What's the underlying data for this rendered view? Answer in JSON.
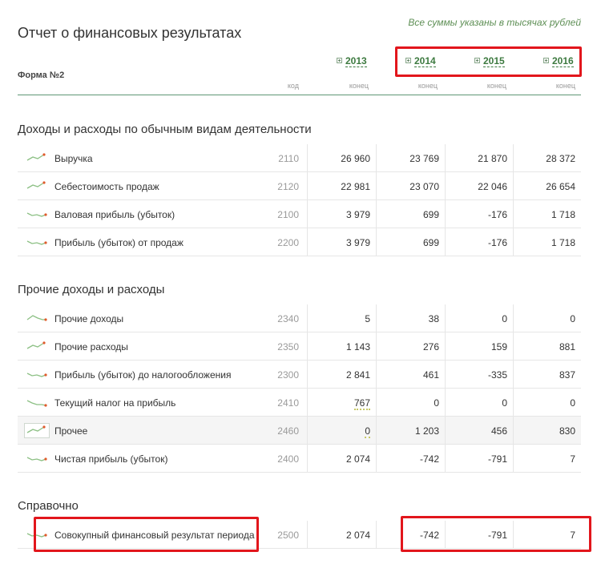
{
  "report": {
    "title": "Отчет о финансовых результатах",
    "note": "Все суммы указаны в тысячах рублей",
    "form_label": "Форма №2",
    "years": [
      "2013",
      "2014",
      "2015",
      "2016"
    ],
    "code_header": "код",
    "period_header": "конец"
  },
  "sections": [
    {
      "title": "Доходы и расходы по обычным видам деятельности",
      "rows": [
        {
          "label": "Выручка",
          "code": "2110",
          "values": [
            "26 960",
            "23 769",
            "21 870",
            "28 372"
          ]
        },
        {
          "label": "Себестоимость продаж",
          "code": "2120",
          "values": [
            "22 981",
            "23 070",
            "22 046",
            "26 654"
          ]
        },
        {
          "label": "Валовая прибыль (убыток)",
          "code": "2100",
          "values": [
            "3 979",
            "699",
            "-176",
            "1 718"
          ]
        },
        {
          "label": "Прибыль (убыток) от продаж",
          "code": "2200",
          "values": [
            "3 979",
            "699",
            "-176",
            "1 718"
          ]
        }
      ]
    },
    {
      "title": "Прочие доходы и расходы",
      "rows": [
        {
          "label": "Прочие доходы",
          "code": "2340",
          "values": [
            "5",
            "38",
            "0",
            "0"
          ]
        },
        {
          "label": "Прочие расходы",
          "code": "2350",
          "values": [
            "1 143",
            "276",
            "159",
            "881"
          ]
        },
        {
          "label": "Прибыль (убыток) до налогообложения",
          "code": "2300",
          "values": [
            "2 841",
            "461",
            "-335",
            "837"
          ]
        },
        {
          "label": "Текущий налог на прибыль",
          "code": "2410",
          "values": [
            "767",
            "0",
            "0",
            "0"
          ]
        },
        {
          "label": "Прочее",
          "code": "2460",
          "values": [
            "0",
            "1 203",
            "456",
            "830"
          ]
        },
        {
          "label": "Чистая прибыль (убыток)",
          "code": "2400",
          "values": [
            "2 074",
            "-742",
            "-791",
            "7"
          ]
        }
      ]
    },
    {
      "title": "Справочно",
      "rows": [
        {
          "label": "Совокупный финансовый результат периода",
          "code": "2500",
          "values": [
            "2 074",
            "-742",
            "-791",
            "7"
          ]
        }
      ]
    }
  ],
  "colors": {
    "accent_green": "#3d7a40",
    "sparkline": "#8cc084",
    "spark_dot": "#e05a2b",
    "highlight_red": "#e2161c"
  },
  "icons": {
    "year_expand": "plus-square-icon",
    "trend": "sparkline-icon"
  }
}
